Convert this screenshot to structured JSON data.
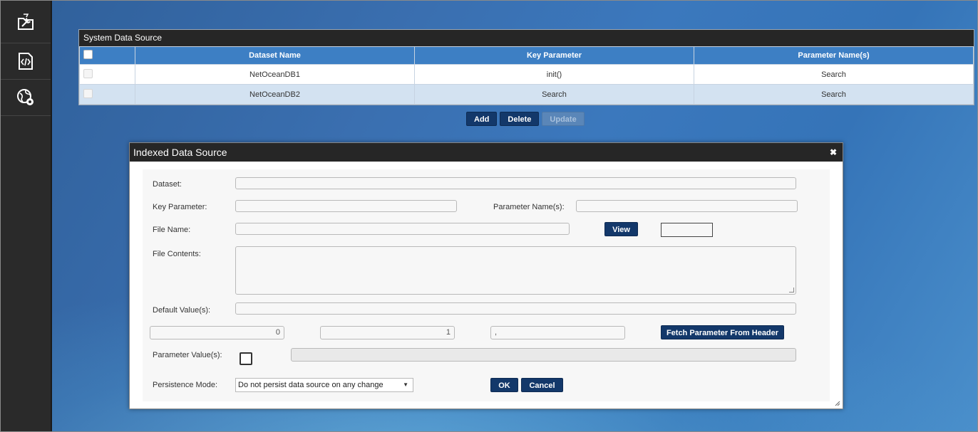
{
  "sidebar": {
    "items": [
      {
        "icon": "tools-folder-icon"
      },
      {
        "icon": "code-file-icon"
      },
      {
        "icon": "globe-settings-icon"
      }
    ]
  },
  "grid": {
    "title": "System Data Source",
    "columns": [
      "",
      "Dataset Name",
      "Key Parameter",
      "Parameter Name(s)"
    ],
    "rows": [
      {
        "dataset": "NetOceanDB1",
        "key": "init()",
        "params": "Search"
      },
      {
        "dataset": "NetOceanDB2",
        "key": "Search",
        "params": "Search"
      }
    ]
  },
  "actions": {
    "add": "Add",
    "delete": "Delete",
    "update": "Update"
  },
  "dialog": {
    "title": "Indexed Data Source",
    "close": "✖",
    "labels": {
      "dataset": "Dataset:",
      "key_parameter": "Key Parameter:",
      "parameter_names": "Parameter Name(s):",
      "file_name": "File Name:",
      "file_contents": "File Contents:",
      "default_values": "Default Value(s):",
      "parameter_values": "Parameter Value(s):",
      "persistence_mode": "Persistence Mode:"
    },
    "values": {
      "dataset": "",
      "key_parameter": "",
      "parameter_names": "",
      "file_name": "",
      "default_values": "",
      "start_index": "0",
      "increment": "1",
      "delimiter": ",",
      "parameter_values": ""
    },
    "buttons": {
      "view": "View",
      "fetch": "Fetch Parameter From Header",
      "ok": "OK",
      "cancel": "Cancel"
    },
    "persistence_selected": "Do not persist data source on any change"
  },
  "colors": {
    "header_blue": "#3d7fc4",
    "button_navy": "#13386a",
    "title_bar": "#262626",
    "alt_row": "#d3e2f1"
  }
}
